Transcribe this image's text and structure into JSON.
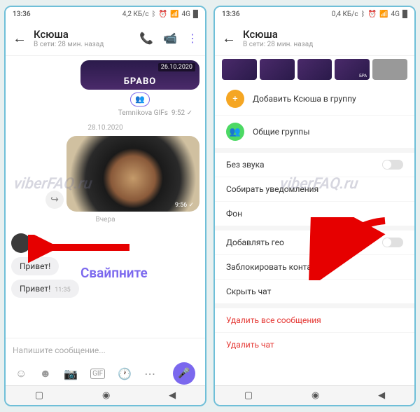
{
  "status_bar": {
    "time": "13:36",
    "net_speed_left": "4,2 КБ/с",
    "net_speed_right": "0,4 КБ/с",
    "bt_icon": "ᛒ",
    "alarm_icon": "⏰",
    "signal_icon": "📶",
    "net_badge": "4G",
    "battery": "█"
  },
  "header": {
    "name": "Ксюша",
    "status": "В сети: 28 мин. назад"
  },
  "media": {
    "bravo_date": "26.10.2020",
    "bravo_text": "БРАВО",
    "gif_label": "Temnikova GIFs",
    "gif_time": "9:52",
    "date_divider": "28.10.2020",
    "food_time": "9:56",
    "yesterday_label": "Вчера"
  },
  "messages": {
    "hi": "Привет!",
    "hi_time": "11:35"
  },
  "input": {
    "placeholder": "Напишите сообщение...",
    "gif_label": "GIF"
  },
  "panel": {
    "add_to_group": "Добавить Ксюша в группу",
    "common_groups": "Общие группы",
    "mute": "Без звука",
    "collect_notifications": "Собирать уведомления",
    "background": "Фон",
    "add_geo": "Добавлять гео",
    "block_contact": "Заблокировать контакт",
    "hide_chat": "Скрыть чат",
    "delete_all": "Удалить все сообщения",
    "delete_chat": "Удалить чат"
  },
  "annotations": {
    "swipe_hint": "Свайпните",
    "watermark": "viberFAQ.ru"
  },
  "thumb_bravo_mini": "БРА"
}
